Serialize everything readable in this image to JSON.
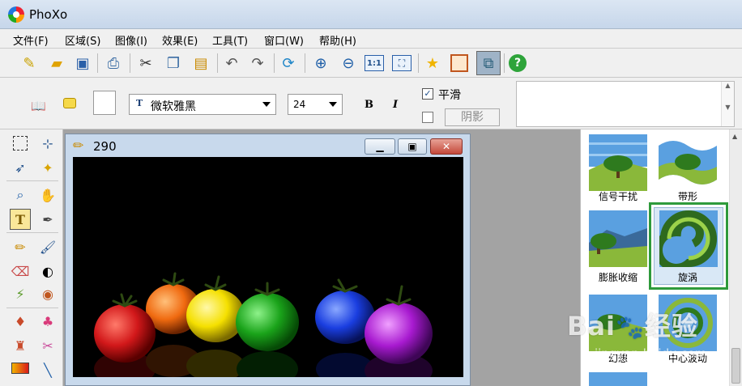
{
  "app": {
    "title": "PhoXo"
  },
  "menu": [
    {
      "label": "文件(F)"
    },
    {
      "label": "区域(S)"
    },
    {
      "label": "图像(I)"
    },
    {
      "label": "效果(E)"
    },
    {
      "label": "工具(T)"
    },
    {
      "label": "窗口(W)"
    },
    {
      "label": "帮助(H)"
    }
  ],
  "toolbar": {
    "icons": [
      "new-icon",
      "open-icon",
      "save-icon",
      "print-icon",
      "cut-icon",
      "copy-icon",
      "paste-icon",
      "undo-icon",
      "redo-icon",
      "refresh-icon",
      "zoom-in-icon",
      "zoom-out-icon",
      "actual-size-icon",
      "fit-window-icon",
      "star-icon",
      "frame-icon",
      "layers-icon",
      "help-icon"
    ],
    "actual_size_label": "1:1",
    "help_label": "?"
  },
  "textbar": {
    "font_name": "微软雅黑",
    "font_size": "24",
    "bold_label": "B",
    "italic_label": "I",
    "smooth_label": "平滑",
    "smooth_checked": true,
    "shadow_checked": false,
    "shadow_button_label": "阴影",
    "font_type_badge": "T"
  },
  "document": {
    "title": "290"
  },
  "effects": [
    {
      "label": "信号干扰",
      "selected": false
    },
    {
      "label": "带形",
      "selected": false
    },
    {
      "label": "膨胀收缩",
      "selected": false
    },
    {
      "label": "旋涡",
      "selected": true
    },
    {
      "label": "幻想",
      "selected": false
    },
    {
      "label": "中心波动",
      "selected": false
    }
  ],
  "watermark": {
    "text": "Bai经验",
    "url": "jingyan.baidu.com"
  },
  "colors": {
    "selection_border": "#2e9a3b",
    "selected_fill": "#d9e8f6"
  }
}
